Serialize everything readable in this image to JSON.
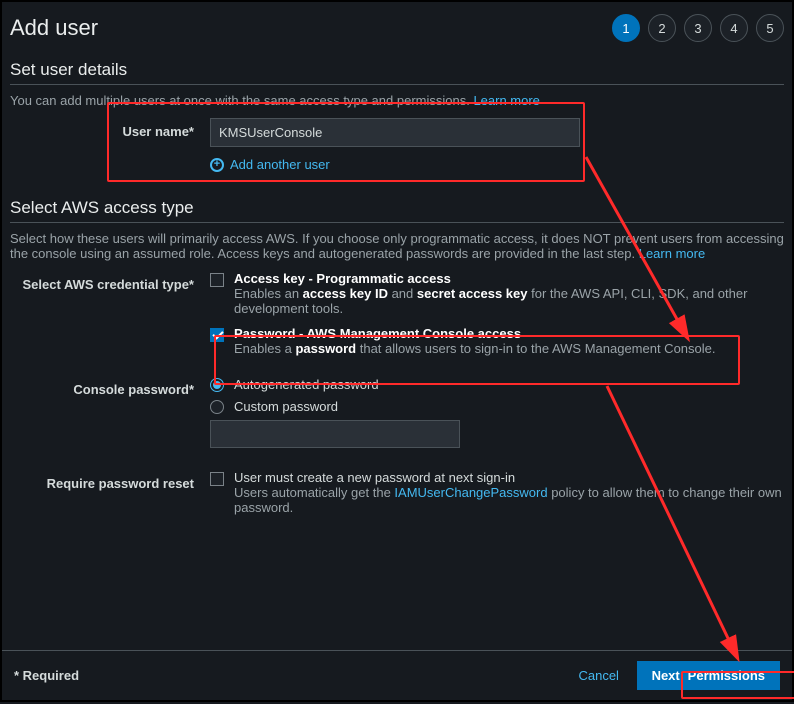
{
  "header": {
    "title": "Add user",
    "steps": [
      "1",
      "2",
      "3",
      "4",
      "5"
    ],
    "active_step": 0
  },
  "user_details": {
    "section_title": "Set user details",
    "description_prefix": "You can add multiple users at once with the same access type and permissions. ",
    "learn_more": "Learn more",
    "username_label": "User name*",
    "username_value": "KMSUserConsole",
    "add_another": "Add another user"
  },
  "access_type": {
    "section_title": "Select AWS access type",
    "description_prefix": "Select how these users will primarily access AWS. If you choose only programmatic access, it does NOT prevent users from accessing the console using an assumed role. Access keys and autogenerated passwords are provided in the last step. ",
    "learn_more": "Learn more",
    "credential_label": "Select AWS credential type*",
    "option_access_key": {
      "title": "Access key - Programmatic access",
      "sub_prefix": "Enables an ",
      "sub_bold1": "access key ID",
      "sub_mid": " and ",
      "sub_bold2": "secret access key",
      "sub_suffix": " for the AWS API, CLI, SDK, and other development tools.",
      "checked": false
    },
    "option_password": {
      "title": "Password - AWS Management Console access",
      "sub_prefix": "Enables a ",
      "sub_bold": "password",
      "sub_suffix": " that allows users to sign-in to the AWS Management Console.",
      "checked": true
    }
  },
  "console_password": {
    "label": "Console password*",
    "autogen": "Autogenerated password",
    "custom": "Custom password",
    "selected": "autogen"
  },
  "require_reset": {
    "label": "Require password reset",
    "line1": "User must create a new password at next sign-in",
    "line2_prefix": "Users automatically get the ",
    "policy_link": "IAMUserChangePassword",
    "line2_suffix": " policy to allow them to change their own password.",
    "checked": false
  },
  "footer": {
    "required": "* Required",
    "cancel": "Cancel",
    "next": "Next: Permissions"
  }
}
